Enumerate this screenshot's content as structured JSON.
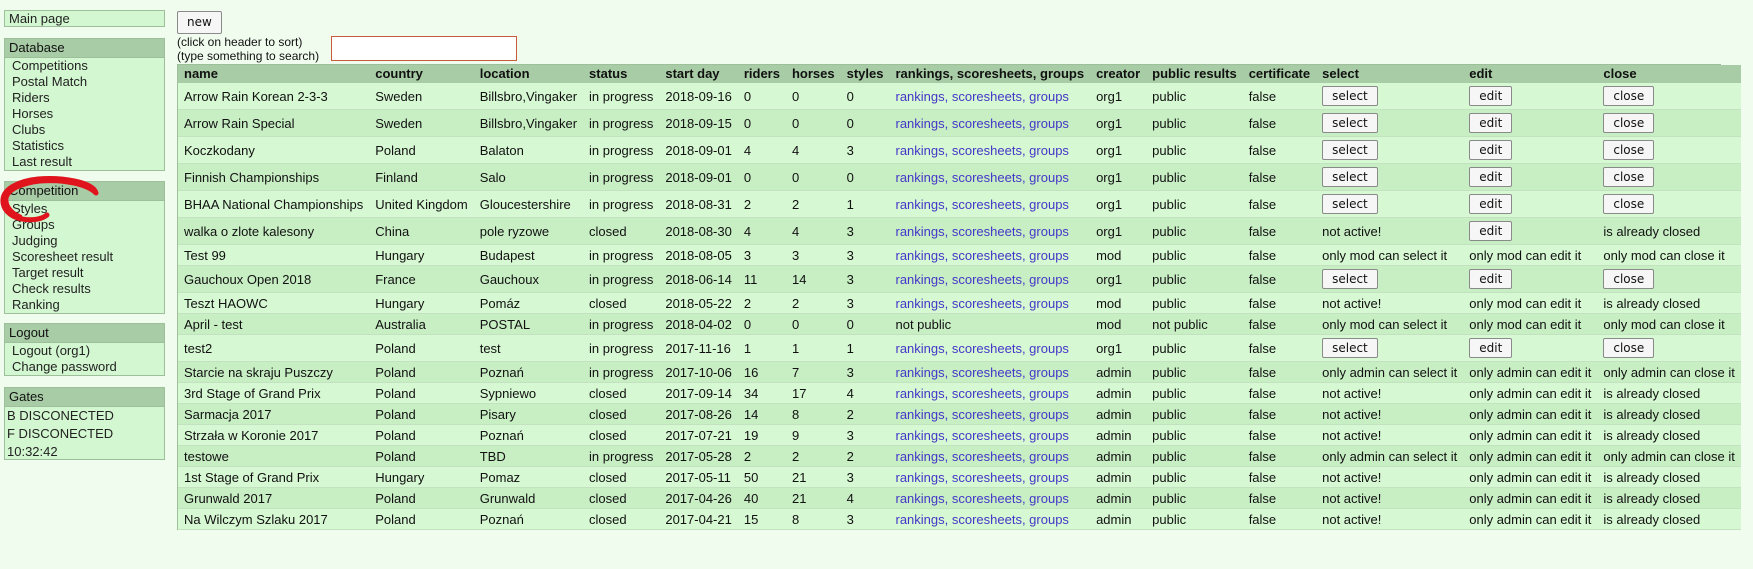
{
  "nav": {
    "main_page": "Main page",
    "database": {
      "header": "Database",
      "items": [
        "Competitions",
        "Postal Match",
        "Riders",
        "Horses",
        "Clubs",
        "Statistics",
        "Last result"
      ]
    },
    "competition": {
      "header": "Competition",
      "items": [
        "Styles",
        "Groups",
        "Judging",
        "Scoresheet result",
        "Target result",
        "Check results",
        "Ranking"
      ]
    },
    "logout": {
      "header": "Logout",
      "items": [
        "Logout (org1)",
        "Change password"
      ]
    },
    "gates": {
      "header": "Gates",
      "items": [
        "B DISCONECTED",
        "F DISCONECTED",
        "10:32:42"
      ]
    }
  },
  "toolbar": {
    "new_label": "new",
    "hint_line1": "(click on header to sort)",
    "hint_line2": "(type something to search)",
    "search_value": ""
  },
  "annotation": {
    "color": "#e0141c",
    "shape": "hand-drawn-circle"
  },
  "table": {
    "columns": [
      "name",
      "country",
      "location",
      "status",
      "start day",
      "riders",
      "horses",
      "styles",
      "rankings, scoresheets, groups",
      "creator",
      "public results",
      "certificate",
      "select",
      "edit",
      "close"
    ],
    "rows": [
      {
        "name": "Arrow Rain Korean 2-3-3",
        "country": "Sweden",
        "location": "Billsbro,Vingaker",
        "status": "in progress",
        "start": "2018-09-16",
        "riders": "0",
        "horses": "0",
        "styles": "0",
        "links": "rankings, scoresheets, groups",
        "creator": "org1",
        "public": "public",
        "cert": "false",
        "select": {
          "type": "button",
          "text": "select"
        },
        "edit": {
          "type": "button",
          "text": "edit"
        },
        "close": {
          "type": "button",
          "text": "close"
        }
      },
      {
        "name": "Arrow Rain Special",
        "country": "Sweden",
        "location": "Billsbro,Vingaker",
        "status": "in progress",
        "start": "2018-09-15",
        "riders": "0",
        "horses": "0",
        "styles": "0",
        "links": "rankings, scoresheets, groups",
        "creator": "org1",
        "public": "public",
        "cert": "false",
        "select": {
          "type": "button",
          "text": "select"
        },
        "edit": {
          "type": "button",
          "text": "edit"
        },
        "close": {
          "type": "button",
          "text": "close"
        }
      },
      {
        "name": "Koczkodany",
        "country": "Poland",
        "location": "Balaton",
        "status": "in progress",
        "start": "2018-09-01",
        "riders": "4",
        "horses": "4",
        "styles": "3",
        "links": "rankings, scoresheets, groups",
        "creator": "org1",
        "public": "public",
        "cert": "false",
        "select": {
          "type": "button",
          "text": "select"
        },
        "edit": {
          "type": "button",
          "text": "edit"
        },
        "close": {
          "type": "button",
          "text": "close"
        }
      },
      {
        "name": "Finnish Championships",
        "country": "Finland",
        "location": "Salo",
        "status": "in progress",
        "start": "2018-09-01",
        "riders": "0",
        "horses": "0",
        "styles": "0",
        "links": "rankings, scoresheets, groups",
        "creator": "org1",
        "public": "public",
        "cert": "false",
        "select": {
          "type": "button",
          "text": "select"
        },
        "edit": {
          "type": "button",
          "text": "edit"
        },
        "close": {
          "type": "button",
          "text": "close"
        }
      },
      {
        "name": "BHAA National Championships",
        "country": "United Kingdom",
        "location": "Gloucestershire",
        "status": "in progress",
        "start": "2018-08-31",
        "riders": "2",
        "horses": "2",
        "styles": "1",
        "links": "rankings, scoresheets, groups",
        "creator": "org1",
        "public": "public",
        "cert": "false",
        "select": {
          "type": "button",
          "text": "select"
        },
        "edit": {
          "type": "button",
          "text": "edit"
        },
        "close": {
          "type": "button",
          "text": "close"
        }
      },
      {
        "name": "walka o zlote kalesony",
        "country": "China",
        "location": "pole ryzowe",
        "status": "closed",
        "start": "2018-08-30",
        "riders": "4",
        "horses": "4",
        "styles": "3",
        "links": "rankings, scoresheets, groups",
        "creator": "org1",
        "public": "public",
        "cert": "false",
        "select": {
          "type": "text",
          "text": "not active!"
        },
        "edit": {
          "type": "button",
          "text": "edit"
        },
        "close": {
          "type": "text",
          "text": "is already closed"
        }
      },
      {
        "name": "Test 99",
        "country": "Hungary",
        "location": "Budapest",
        "status": "in progress",
        "start": "2018-08-05",
        "riders": "3",
        "horses": "3",
        "styles": "3",
        "links": "rankings, scoresheets, groups",
        "creator": "mod",
        "public": "public",
        "cert": "false",
        "select": {
          "type": "text",
          "text": "only mod can select it"
        },
        "edit": {
          "type": "text",
          "text": "only mod can edit it"
        },
        "close": {
          "type": "text",
          "text": "only mod can close it"
        }
      },
      {
        "name": "Gauchoux Open 2018",
        "country": "France",
        "location": "Gauchoux",
        "status": "in progress",
        "start": "2018-06-14",
        "riders": "11",
        "horses": "14",
        "styles": "3",
        "links": "rankings, scoresheets, groups",
        "creator": "org1",
        "public": "public",
        "cert": "false",
        "select": {
          "type": "button",
          "text": "select"
        },
        "edit": {
          "type": "button",
          "text": "edit"
        },
        "close": {
          "type": "button",
          "text": "close"
        }
      },
      {
        "name": "Teszt HAOWC",
        "country": "Hungary",
        "location": "Pomáz",
        "status": "closed",
        "start": "2018-05-22",
        "riders": "2",
        "horses": "2",
        "styles": "3",
        "links": "rankings, scoresheets, groups",
        "creator": "mod",
        "public": "public",
        "cert": "false",
        "select": {
          "type": "text",
          "text": "not active!"
        },
        "edit": {
          "type": "text",
          "text": "only mod can edit it"
        },
        "close": {
          "type": "text",
          "text": "is already closed"
        }
      },
      {
        "name": "April - test",
        "country": "Australia",
        "location": "POSTAL",
        "status": "in progress",
        "start": "2018-04-02",
        "riders": "0",
        "horses": "0",
        "styles": "0",
        "links": "not public",
        "linkless": true,
        "creator": "mod",
        "public": "not public",
        "cert": "false",
        "select": {
          "type": "text",
          "text": "only mod can select it"
        },
        "edit": {
          "type": "text",
          "text": "only mod can edit it"
        },
        "close": {
          "type": "text",
          "text": "only mod can close it"
        }
      },
      {
        "name": "test2",
        "country": "Poland",
        "location": "test",
        "status": "in progress",
        "start": "2017-11-16",
        "riders": "1",
        "horses": "1",
        "styles": "1",
        "links": "rankings, scoresheets, groups",
        "creator": "org1",
        "public": "public",
        "cert": "false",
        "select": {
          "type": "button",
          "text": "select"
        },
        "edit": {
          "type": "button",
          "text": "edit"
        },
        "close": {
          "type": "button",
          "text": "close"
        }
      },
      {
        "name": "Starcie na skraju Puszczy",
        "country": "Poland",
        "location": "Poznań",
        "status": "in progress",
        "start": "2017-10-06",
        "riders": "16",
        "horses": "7",
        "styles": "3",
        "links": "rankings, scoresheets, groups",
        "creator": "admin",
        "public": "public",
        "cert": "false",
        "select": {
          "type": "text",
          "text": "only admin can select it"
        },
        "edit": {
          "type": "text",
          "text": "only admin can edit it"
        },
        "close": {
          "type": "text",
          "text": "only admin can close it"
        }
      },
      {
        "name": "3rd Stage of Grand Prix",
        "country": "Poland",
        "location": "Sypniewo",
        "status": "closed",
        "start": "2017-09-14",
        "riders": "34",
        "horses": "17",
        "styles": "4",
        "links": "rankings, scoresheets, groups",
        "creator": "admin",
        "public": "public",
        "cert": "false",
        "select": {
          "type": "text",
          "text": "not active!"
        },
        "edit": {
          "type": "text",
          "text": "only admin can edit it"
        },
        "close": {
          "type": "text",
          "text": "is already closed"
        }
      },
      {
        "name": "Sarmacja 2017",
        "country": "Poland",
        "location": "Pisary",
        "status": "closed",
        "start": "2017-08-26",
        "riders": "14",
        "horses": "8",
        "styles": "2",
        "links": "rankings, scoresheets, groups",
        "creator": "admin",
        "public": "public",
        "cert": "false",
        "select": {
          "type": "text",
          "text": "not active!"
        },
        "edit": {
          "type": "text",
          "text": "only admin can edit it"
        },
        "close": {
          "type": "text",
          "text": "is already closed"
        }
      },
      {
        "name": "Strzała w Koronie 2017",
        "country": "Poland",
        "location": "Poznań",
        "status": "closed",
        "start": "2017-07-21",
        "riders": "19",
        "horses": "9",
        "styles": "3",
        "links": "rankings, scoresheets, groups",
        "creator": "admin",
        "public": "public",
        "cert": "false",
        "select": {
          "type": "text",
          "text": "not active!"
        },
        "edit": {
          "type": "text",
          "text": "only admin can edit it"
        },
        "close": {
          "type": "text",
          "text": "is already closed"
        }
      },
      {
        "name": "testowe",
        "country": "Poland",
        "location": "TBD",
        "status": "in progress",
        "start": "2017-05-28",
        "riders": "2",
        "horses": "2",
        "styles": "2",
        "links": "rankings, scoresheets, groups",
        "creator": "admin",
        "public": "public",
        "cert": "false",
        "select": {
          "type": "text",
          "text": "only admin can select it"
        },
        "edit": {
          "type": "text",
          "text": "only admin can edit it"
        },
        "close": {
          "type": "text",
          "text": "only admin can close it"
        }
      },
      {
        "name": "1st Stage of Grand Prix",
        "country": "Hungary",
        "location": "Pomaz",
        "status": "closed",
        "start": "2017-05-11",
        "riders": "50",
        "horses": "21",
        "styles": "3",
        "links": "rankings, scoresheets, groups",
        "creator": "admin",
        "public": "public",
        "cert": "false",
        "select": {
          "type": "text",
          "text": "not active!"
        },
        "edit": {
          "type": "text",
          "text": "only admin can edit it"
        },
        "close": {
          "type": "text",
          "text": "is already closed"
        }
      },
      {
        "name": "Grunwald 2017",
        "country": "Poland",
        "location": "Grunwald",
        "status": "closed",
        "start": "2017-04-26",
        "riders": "40",
        "horses": "21",
        "styles": "4",
        "links": "rankings, scoresheets, groups",
        "creator": "admin",
        "public": "public",
        "cert": "false",
        "select": {
          "type": "text",
          "text": "not active!"
        },
        "edit": {
          "type": "text",
          "text": "only admin can edit it"
        },
        "close": {
          "type": "text",
          "text": "is already closed"
        }
      },
      {
        "name": "Na Wilczym Szlaku 2017",
        "country": "Poland",
        "location": "Poznań",
        "status": "closed",
        "start": "2017-04-21",
        "riders": "15",
        "horses": "8",
        "styles": "3",
        "links": "rankings, scoresheets, groups",
        "creator": "admin",
        "public": "public",
        "cert": "false",
        "select": {
          "type": "text",
          "text": "not active!"
        },
        "edit": {
          "type": "text",
          "text": "only admin can edit it"
        },
        "close": {
          "type": "text",
          "text": "is already closed"
        }
      }
    ]
  }
}
